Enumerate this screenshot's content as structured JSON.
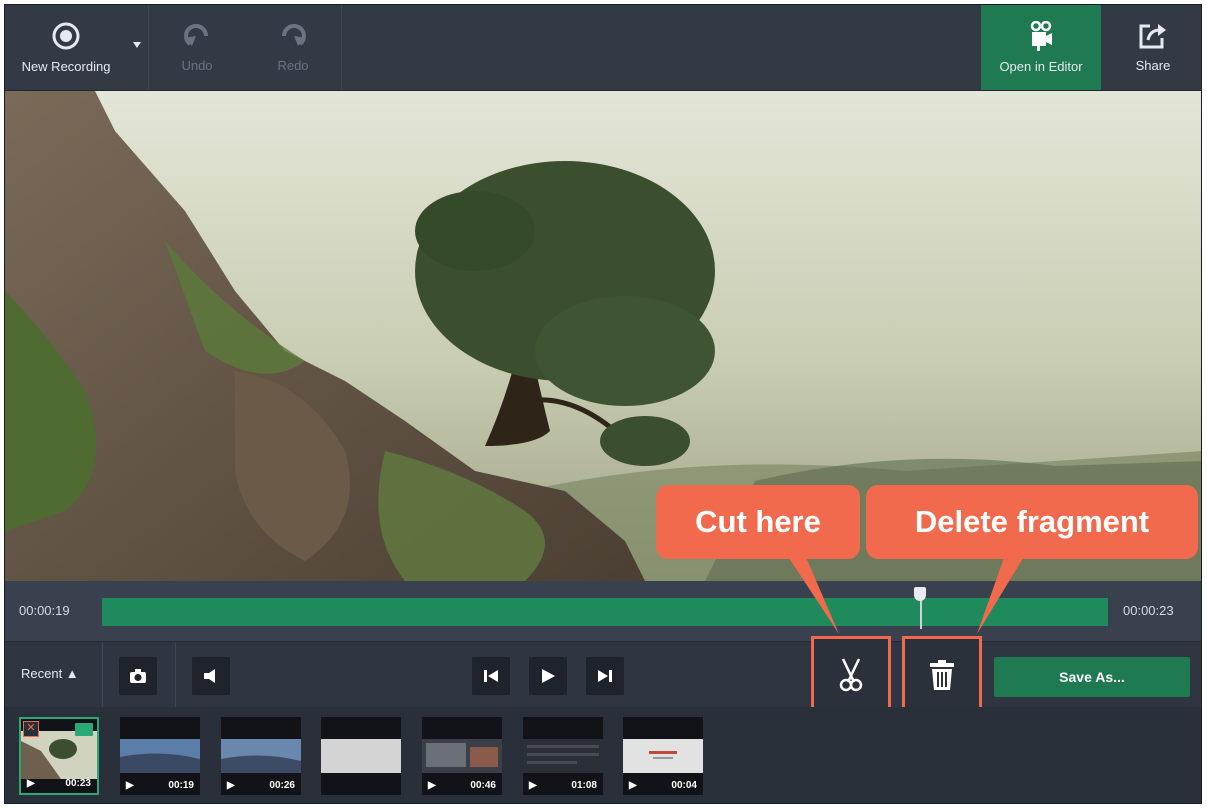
{
  "toolbar": {
    "new_recording": "New Recording",
    "undo": "Undo",
    "redo": "Redo",
    "open_in_editor": "Open in Editor",
    "share": "Share"
  },
  "timeline": {
    "start_time": "00:00:19",
    "end_time": "00:00:23"
  },
  "controls": {
    "recent": "Recent ▲",
    "save_as": "Save As..."
  },
  "thumbnails": [
    {
      "duration": "00:23"
    },
    {
      "duration": "00:19"
    },
    {
      "duration": "00:26"
    },
    {
      "duration": ""
    },
    {
      "duration": "00:46"
    },
    {
      "duration": "01:08"
    },
    {
      "duration": "00:04"
    }
  ],
  "callouts": {
    "cut": "Cut here",
    "delete": "Delete fragment"
  },
  "colors": {
    "accent_green": "#1f7a52",
    "callout": "#f26a4d"
  }
}
